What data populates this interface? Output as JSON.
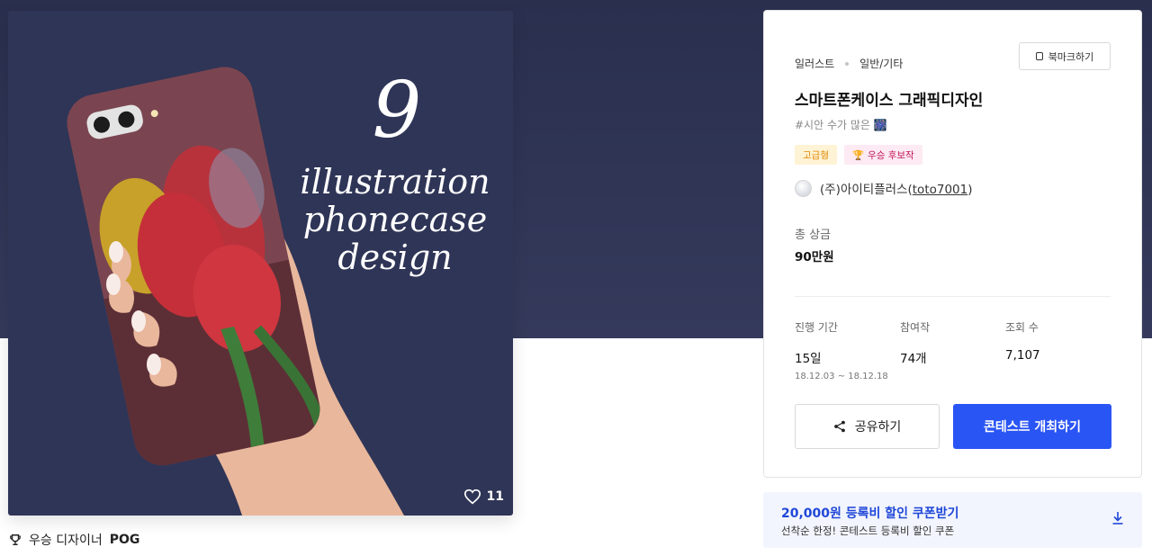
{
  "artwork": {
    "number": "9",
    "lines": [
      "illustration",
      "phonecase",
      "design"
    ],
    "likes": "11"
  },
  "winner": {
    "label": "우승 디자이너",
    "name": "POG"
  },
  "contest": {
    "category": "일러스트",
    "subcategory": "일반/기타",
    "bookmark_label": "북마크하기",
    "title": "스마트폰케이스 그래픽디자인",
    "tagline": "#시안 수가 많은 🎆",
    "badge_grade": "고급형",
    "badge_winner": "우승 후보작",
    "host_name": "(주)아이티플러스",
    "host_id": "toto7001",
    "prize_label": "총 상금",
    "prize_value": "90만원",
    "stats": {
      "period_label": "진행 기간",
      "period_value": "15일",
      "period_range": "18.12.03 ~ 18.12.18",
      "entries_label": "참여작",
      "entries_value": "74개",
      "views_label": "조회 수",
      "views_value": "7,107"
    },
    "share_label": "공유하기",
    "host_contest_label": "콘테스트 개최하기"
  },
  "coupon": {
    "title": "20,000원 등록비 할인 쿠폰받기",
    "desc": "선착순 한정! 콘테스트 등록비 할인 쿠폰"
  },
  "colors": {
    "hero_bg": "#2a2f4e",
    "primary": "#2a55f5",
    "coupon_text": "#1f47d8"
  }
}
